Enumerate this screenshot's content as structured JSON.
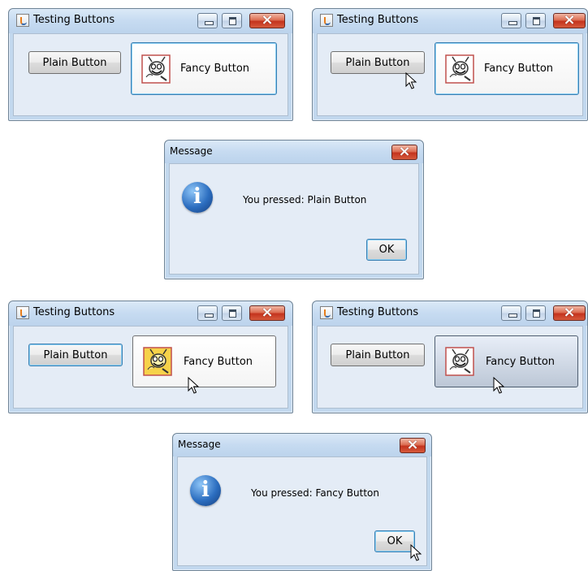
{
  "frames": [
    {
      "title": "Testing Buttons",
      "plain_button": "Plain Button",
      "fancy_button": "Fancy Button"
    },
    {
      "title": "Testing Buttons",
      "plain_button": "Plain Button",
      "fancy_button": "Fancy Button"
    },
    {
      "title": "Message",
      "message": "You pressed: Plain Button",
      "ok_button": "OK"
    },
    {
      "title": "Testing Buttons",
      "plain_button": "Plain Button",
      "fancy_button": "Fancy Button"
    },
    {
      "title": "Testing Buttons",
      "plain_button": "Plain Button",
      "fancy_button": "Fancy Button"
    },
    {
      "title": "Message",
      "message": "You pressed: Fancy Button",
      "ok_button": "OK"
    }
  ],
  "icons": {
    "app": "java-cup-icon",
    "info": "information-icon",
    "fancy_default": "bug-icon",
    "fancy_rollover": "bug-rollover-icon"
  },
  "colors": {
    "window_bg": "#c2d8ee",
    "content_bg": "#e4ecf6",
    "focus_border": "#3c7fb1",
    "close_red": "#c4331d",
    "info_blue": "#2c6ec0"
  }
}
